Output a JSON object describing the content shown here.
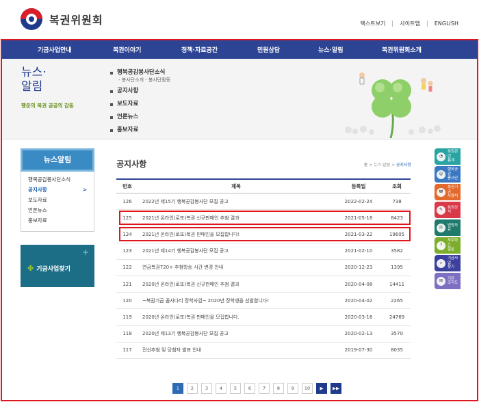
{
  "header": {
    "logo_text": "복권위원회",
    "util_links": [
      "텍스트보기",
      "사이트맵",
      "ENGLISH"
    ]
  },
  "gnb": [
    {
      "label": "기금사업안내"
    },
    {
      "label": "복권이야기"
    },
    {
      "label": "정책·자료공간"
    },
    {
      "label": "민원상담"
    },
    {
      "label": "뉴스·알림"
    },
    {
      "label": "복권위원회소개"
    }
  ],
  "visual": {
    "title_line1": "뉴스·",
    "title_line2": "알림",
    "slogan": "행운의 복권 공공의 감동",
    "submenu": {
      "item1": "행복공감봉사단소식",
      "item1_subs": "- 봉사단소개  - 봉사단활동",
      "item2": "공지사항",
      "item3": "보도자료",
      "item4": "언론뉴스",
      "item5": "홍보자료"
    }
  },
  "lnb": {
    "title": "뉴스알림",
    "items": [
      "행복공감봉사단소식",
      "공지사항",
      "보도자료",
      "언론뉴스",
      "홍보자료"
    ],
    "active_arrow": ">",
    "find_label": "기금사업찾기"
  },
  "content": {
    "title": "공지사항",
    "location": [
      "홈",
      "뉴스·알림",
      "공지사항"
    ],
    "columns": {
      "no": "번호",
      "title": "제목",
      "date": "등록일",
      "views": "조회"
    },
    "rows": [
      {
        "no": "126",
        "title": "2022년 제15기 행복공감봉사단 모집 공고",
        "date": "2022-02-24",
        "views": "738"
      },
      {
        "no": "125",
        "title": "2021년 온라인(로또)복권 신규판매인 추첨 결과",
        "date": "2021-05-18",
        "views": "8423"
      },
      {
        "no": "124",
        "title": "2021년 온라인(로또)복권 판매인을 모집합니다!",
        "date": "2021-03-22",
        "views": "19605"
      },
      {
        "no": "123",
        "title": "2021년 제14기 행복공감봉사단 모집 공고",
        "date": "2021-02-10",
        "views": "3582"
      },
      {
        "no": "122",
        "title": "연금복권720+ 추첨방송 시간 변경 안내",
        "date": "2020-12-23",
        "views": "1395"
      },
      {
        "no": "121",
        "title": "2020년 온라인(로또)복권 신규판매인 추첨 결과",
        "date": "2020-04-08",
        "views": "14411"
      },
      {
        "no": "120",
        "title": "~복권기금 꿈사다리 장학사업~ 2020년 장학생을 선발합니다!",
        "date": "2020-04-02",
        "views": "2265"
      },
      {
        "no": "119",
        "title": "2020년 온라인(로또)복권 판매인을 모집합니다.",
        "date": "2020-03-16",
        "views": "24769"
      },
      {
        "no": "118",
        "title": "2020년 제13기 행복공감봉사단 모집 공고",
        "date": "2020-02-13",
        "views": "3570"
      },
      {
        "no": "117",
        "title": "전산추첨 및 당첨자 발표 안내",
        "date": "2019-07-30",
        "views": "8035"
      }
    ]
  },
  "paging": {
    "pages": [
      "1",
      "2",
      "3",
      "4",
      "5",
      "6",
      "7",
      "8",
      "9",
      "10"
    ],
    "current": "1",
    "next": "▶",
    "last": "▶▶"
  },
  "quick": [
    {
      "label": "복권관련\n통계",
      "color": "#2aa3a3",
      "icon": "chart-icon",
      "glyph": "◔"
    },
    {
      "label": "행복공감\n봉사단",
      "color": "#3a78c2",
      "icon": "people-icon",
      "glyph": "☺"
    },
    {
      "label": "복권기금\n사용처",
      "color": "#e26a2c",
      "icon": "money-icon",
      "glyph": "₩"
    },
    {
      "label": "복권상식",
      "color": "#d83a4a",
      "icon": "bulb-icon",
      "glyph": "✎"
    },
    {
      "label": "법령자료",
      "color": "#1f7a6b",
      "icon": "law-icon",
      "glyph": "⚖"
    },
    {
      "label": "자주하는\n질문",
      "color": "#7cae2c",
      "icon": "faq-icon",
      "glyph": "?"
    },
    {
      "label": "기금사업\n찾기",
      "color": "#3b3f9e",
      "icon": "search-icon",
      "glyph": "⌕"
    },
    {
      "label": "기관\n조직도",
      "color": "#7e6fc2",
      "icon": "org-icon",
      "glyph": "⊞"
    }
  ]
}
